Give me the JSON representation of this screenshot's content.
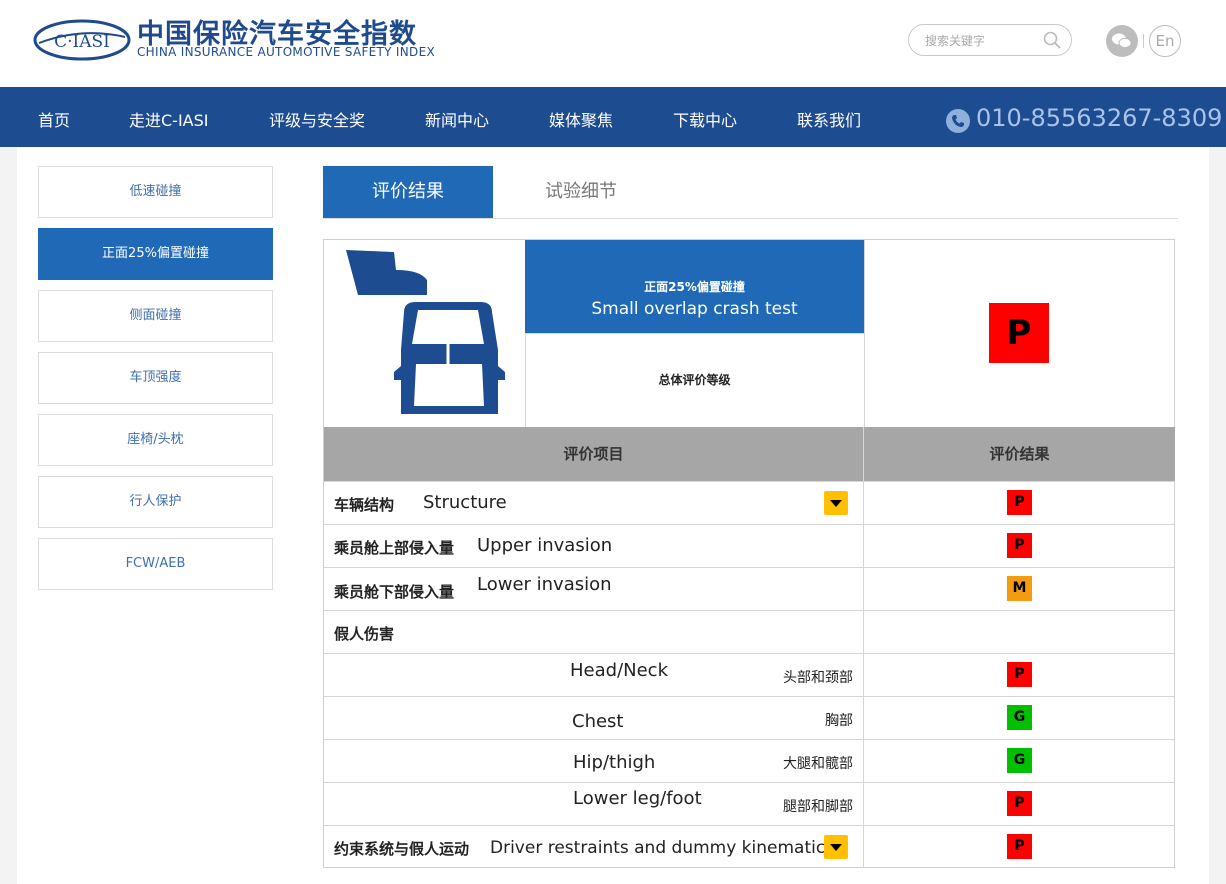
{
  "header": {
    "logo_text": "C·IASI",
    "brand_cn": "中国保险汽车安全指数",
    "brand_en": "CHINA INSURANCE AUTOMOTIVE SAFETY INDEX",
    "search_placeholder": "搜索关键字",
    "lang_button": "En",
    "icons": [
      "search-icon",
      "wechat-icon"
    ]
  },
  "nav": {
    "items": [
      "首页",
      "走进C-IASI",
      "评级与安全奖",
      "新闻中心",
      "媒体聚焦",
      "下载中心",
      "联系我们"
    ],
    "phone": "010-85563267-8309"
  },
  "sidebar": {
    "items": [
      "低速碰撞",
      "正面25%偏置碰撞",
      "侧面碰撞",
      "车顶强度",
      "座椅/头枕",
      "行人保护",
      "FCW/AEB"
    ],
    "active": "正面25%偏置碰撞"
  },
  "tabs": {
    "items": [
      "评价结果",
      "试验细节"
    ],
    "active": "评价结果"
  },
  "result": {
    "test_cn": "正面25%偏置碰撞",
    "test_en": "Small overlap crash test",
    "overall_label": "总体评价等级",
    "overall_rating": "P",
    "col_item": "评价项目",
    "col_result": "评价结果",
    "rows": [
      {
        "cn": "车辆结构",
        "en": "Structure",
        "rating": "P",
        "dropdown": true
      },
      {
        "cn": "乘员舱上部侵入量",
        "en": "Upper invasion",
        "rating": "P"
      },
      {
        "cn": "乘员舱下部侵入量",
        "en": "Lower invasion",
        "rating": "M"
      },
      {
        "cn": "假人伤害",
        "en": "",
        "rating": ""
      },
      {
        "cn": "头部和颈部",
        "en": "Head/Neck",
        "rating": "P"
      },
      {
        "cn": "胸部",
        "en": "Chest",
        "rating": "G"
      },
      {
        "cn": "大腿和髋部",
        "en": "Hip/thigh",
        "rating": "G"
      },
      {
        "cn": "腿部和脚部",
        "en": "Lower leg/foot",
        "rating": "P"
      },
      {
        "cn": "约束系统与假人运动",
        "en": "Driver restraints and dummy kinematics",
        "rating": "P",
        "dropdown": true
      }
    ]
  },
  "colors": {
    "nav_bg": "#1d4c91",
    "accent": "#1f69b6",
    "rating_P": "#ff0000",
    "rating_M": "#f39c12",
    "rating_G": "#00c000",
    "dropdown": "#ffc000"
  }
}
